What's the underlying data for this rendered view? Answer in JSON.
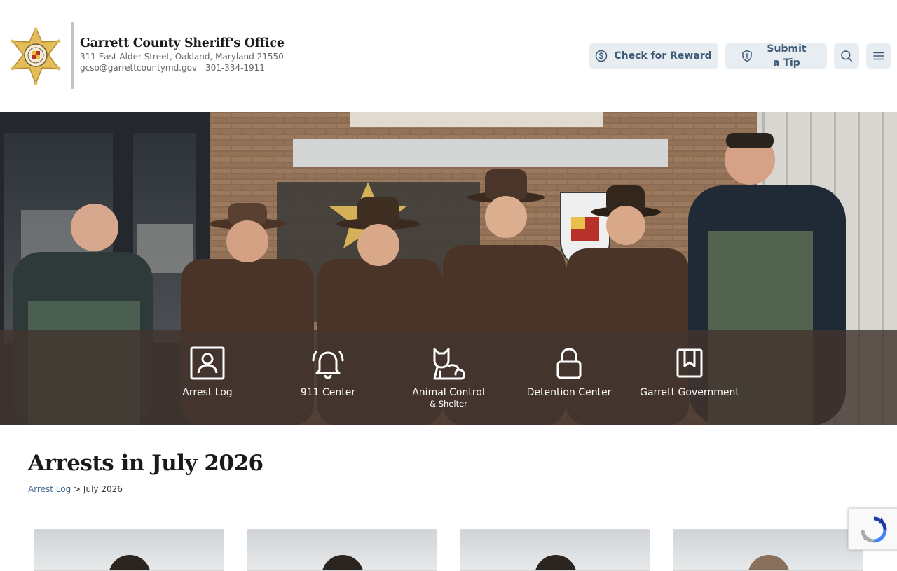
{
  "header": {
    "org_name": "Garrett County Sheriff's Office",
    "address": "311 East Alder Street, Oakland, Maryland 21550",
    "email": "gcso@garrettcountymd.gov",
    "phone": "301-334-1911",
    "buttons": {
      "reward": "Check for Reward",
      "tip": "Submit a Tip"
    },
    "icons": {
      "reward": "dollar-circle-icon",
      "tip": "shield-icon",
      "search": "search-icon",
      "menu": "hamburger-menu-icon"
    }
  },
  "hero": {
    "photo_alt": "Garrett County Dept. of Public Safety deputies group photo",
    "quick_links": [
      {
        "label": "Arrest Log",
        "sub": "",
        "icon": "portrait-icon"
      },
      {
        "label": "911 Center",
        "sub": "",
        "icon": "bell-icon"
      },
      {
        "label": "Animal Control",
        "sub": "& Shelter",
        "icon": "cat-icon"
      },
      {
        "label": "Detention Center",
        "sub": "",
        "icon": "lock-icon"
      },
      {
        "label": "Garrett Government",
        "sub": "",
        "icon": "bookmark-icon"
      }
    ]
  },
  "main": {
    "title": "Arrests in July 2026",
    "breadcrumb": {
      "parent": "Arrest Log",
      "separator": ">",
      "current": "July 2026"
    }
  },
  "colors": {
    "button_bg": "#e8edf2",
    "button_text": "#3e5a75",
    "link": "#3f6a96",
    "quick_bar": "#42342e"
  }
}
